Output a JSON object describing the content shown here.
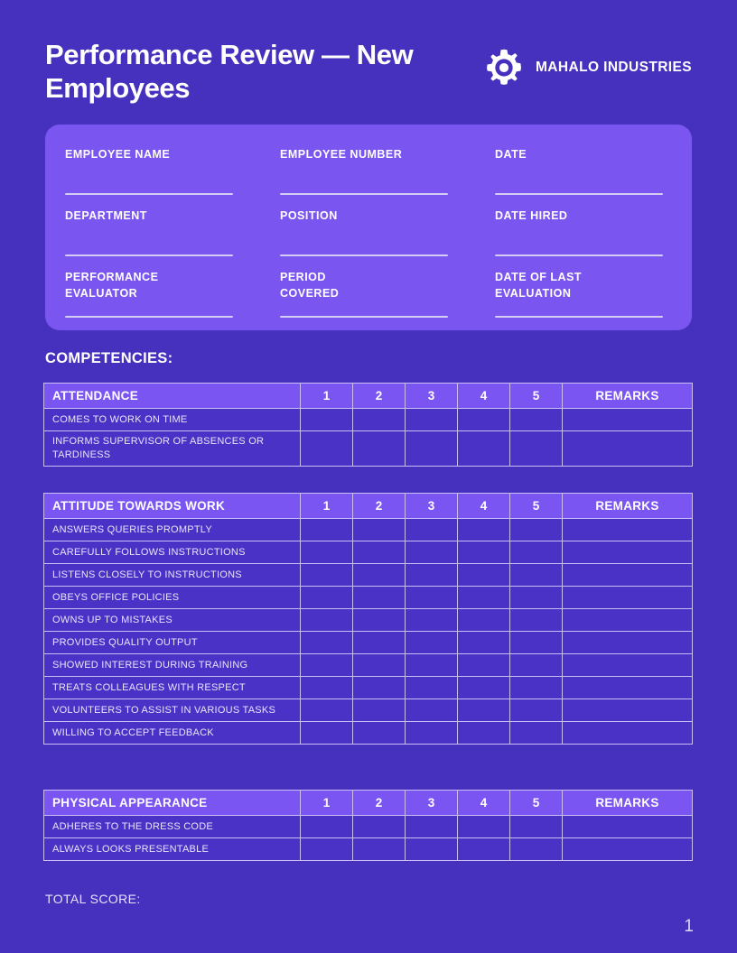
{
  "header": {
    "title": "Performance Review — New Employees",
    "brand_icon": "gear-icon",
    "brand_name": "MAHALO INDUSTRIES"
  },
  "info_panel": {
    "fields": [
      {
        "label": "EMPLOYEE NAME",
        "value": ""
      },
      {
        "label": "EMPLOYEE NUMBER",
        "value": ""
      },
      {
        "label": "DATE",
        "value": ""
      },
      {
        "label": "DEPARTMENT",
        "value": ""
      },
      {
        "label": "POSITION",
        "value": ""
      },
      {
        "label": "DATE HIRED",
        "value": ""
      },
      {
        "label": "PERFORMANCE\nEVALUATOR",
        "value": ""
      },
      {
        "label": "PERIOD\nCOVERED",
        "value": ""
      },
      {
        "label": "DATE OF LAST\nEVALUATION",
        "value": ""
      }
    ]
  },
  "section_heading": "COMPETENCIES:",
  "rating_scale": [
    "1",
    "2",
    "3",
    "4",
    "5"
  ],
  "remarks_header": "REMARKS",
  "tables": [
    {
      "category": "ATTENDANCE",
      "rows": [
        "COMES TO WORK ON TIME",
        "INFORMS SUPERVISOR OF ABSENCES OR TARDINESS"
      ]
    },
    {
      "category": "ATTITUDE TOWARDS WORK",
      "rows": [
        "ANSWERS QUERIES PROMPTLY",
        "CAREFULLY FOLLOWS INSTRUCTIONS",
        "LISTENS CLOSELY TO INSTRUCTIONS",
        "OBEYS OFFICE POLICIES",
        "OWNS UP TO MISTAKES",
        "PROVIDES QUALITY OUTPUT",
        "SHOWED INTEREST DURING TRAINING",
        "TREATS COLLEAGUES WITH RESPECT",
        "VOLUNTEERS TO ASSIST IN VARIOUS TASKS",
        "WILLING TO ACCEPT FEEDBACK"
      ]
    },
    {
      "category": "PHYSICAL APPEARANCE",
      "rows": [
        "ADHERES TO THE DRESS CODE",
        "ALWAYS LOOKS PRESENTABLE"
      ]
    }
  ],
  "footer": {
    "total_score_label": "TOTAL SCORE:",
    "page_number": "1"
  },
  "colors": {
    "background": "#4630be",
    "panel": "#7a55f0",
    "table_header": "#7b55f2",
    "table_cell": "#4a32c6",
    "grid_line": "#c9bdf2",
    "underline": "#d5cdf4",
    "text": "#ffffff"
  }
}
